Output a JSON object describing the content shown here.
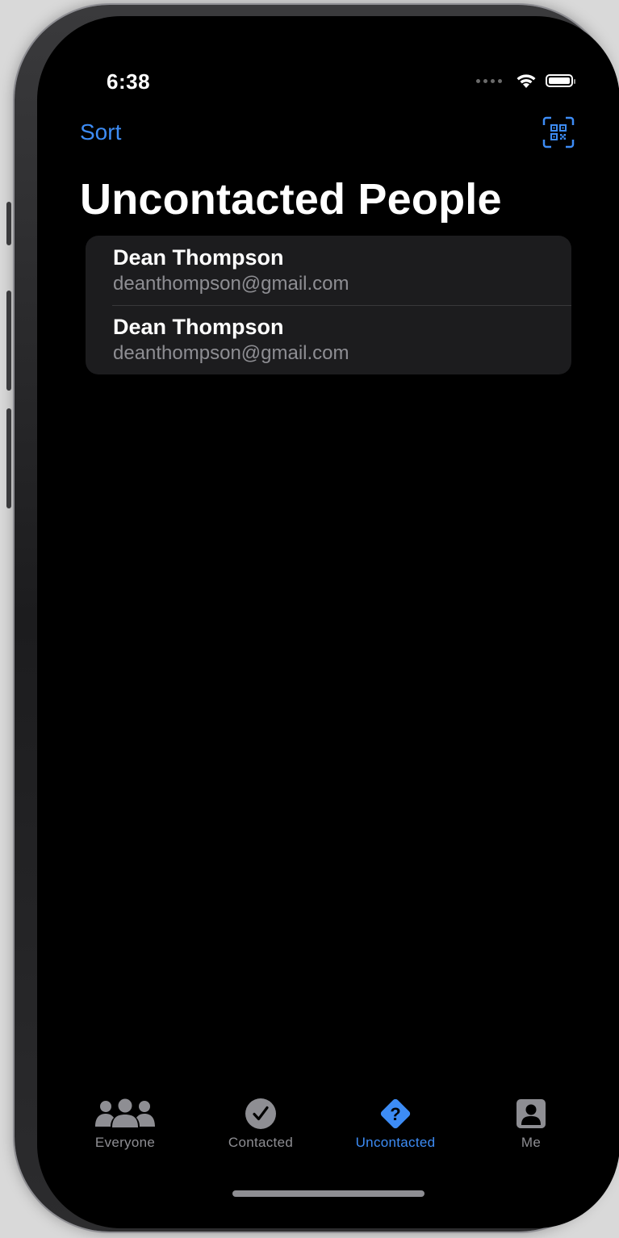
{
  "status_bar": {
    "time": "6:38"
  },
  "nav": {
    "sort_label": "Sort",
    "qr_icon": "qr-code-scan-icon",
    "title": "Uncontacted People"
  },
  "people": [
    {
      "name": "Dean Thompson",
      "email": "deanthompson@gmail.com"
    },
    {
      "name": "Dean Thompson",
      "email": "deanthompson@gmail.com"
    }
  ],
  "tabs": [
    {
      "label": "Everyone",
      "icon": "people-icon",
      "active": false
    },
    {
      "label": "Contacted",
      "icon": "checkmark-circle-icon",
      "active": false
    },
    {
      "label": "Uncontacted",
      "icon": "questionmark-diamond-icon",
      "active": true
    },
    {
      "label": "Me",
      "icon": "person-square-icon",
      "active": false
    }
  ],
  "colors": {
    "accent": "#3d8cf5",
    "background": "#000000",
    "card": "#1c1c1e",
    "secondary_text": "#8e8e93"
  }
}
